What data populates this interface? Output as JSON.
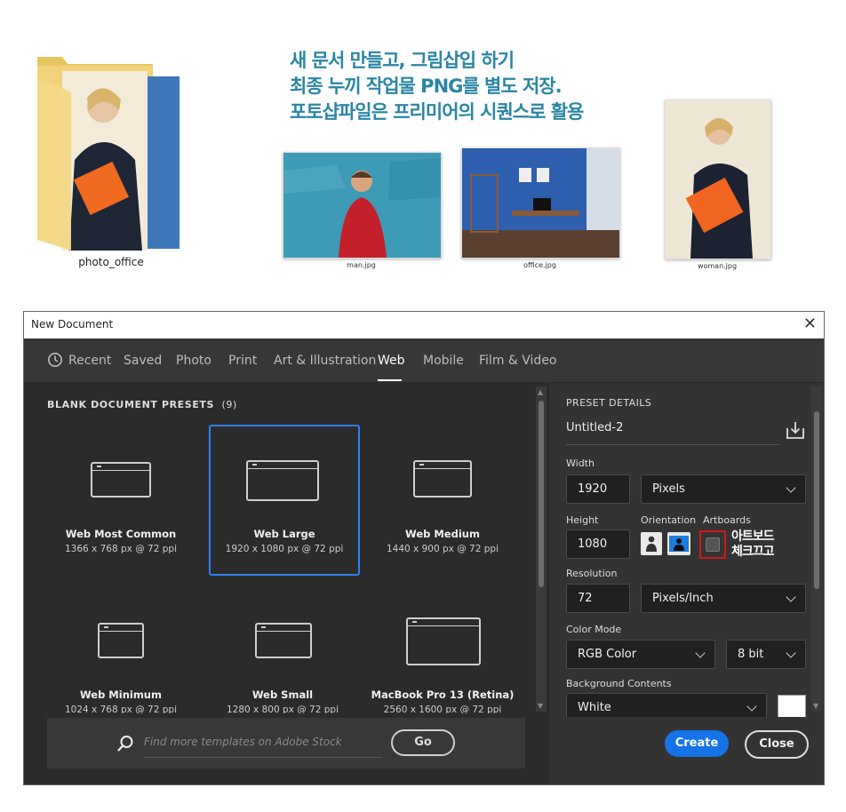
{
  "top": {
    "folder_label": "photo_office",
    "instructions": [
      "새 문서 만들고, 그림삽입 하기",
      "최종 누끼 작업물 PNG를 별도 저장.",
      "포토샵파일은 프리미어의 시퀀스로 활용"
    ],
    "thumbnails": [
      {
        "label": "man.jpg"
      },
      {
        "label": "office.jpg"
      },
      {
        "label": "woman.jpg"
      }
    ]
  },
  "dialog": {
    "title": "New Document",
    "tabs": [
      {
        "label": "Recent"
      },
      {
        "label": "Saved"
      },
      {
        "label": "Photo"
      },
      {
        "label": "Print"
      },
      {
        "label": "Art & Illustration"
      },
      {
        "label": "Web"
      },
      {
        "label": "Mobile"
      },
      {
        "label": "Film & Video"
      }
    ],
    "active_tab": "Web",
    "presets_title": "BLANK DOCUMENT PRESETS",
    "presets_count": "(9)",
    "presets": [
      {
        "name": "Web Most Common",
        "dims": "1366 x 768 px @ 72 ppi"
      },
      {
        "name": "Web Large",
        "dims": "1920 x 1080 px @ 72 ppi"
      },
      {
        "name": "Web Medium",
        "dims": "1440 x 900 px @ 72 ppi"
      },
      {
        "name": "Web Minimum",
        "dims": "1024 x 768 px @ 72 ppi"
      },
      {
        "name": "Web Small",
        "dims": "1280 x 800 px @ 72 ppi"
      },
      {
        "name": "MacBook Pro 13 (Retina)",
        "dims": "2560 x 1600 px @ 72 ppi"
      }
    ],
    "search": {
      "placeholder": "Find more templates on Adobe Stock",
      "go_label": "Go"
    },
    "details": {
      "header": "PRESET DETAILS",
      "name": "Untitled-2",
      "width_label": "Width",
      "width": "1920",
      "width_unit": "Pixels",
      "height_label": "Height",
      "height": "1080",
      "orientation_label": "Orientation",
      "artboards_label": "Artboards",
      "artboard_note": [
        "아트보드",
        "체크끄고"
      ],
      "resolution_label": "Resolution",
      "resolution": "72",
      "resolution_unit": "Pixels/Inch",
      "color_mode_label": "Color Mode",
      "color_mode": "RGB Color",
      "bit_depth": "8 bit",
      "background_label": "Background Contents",
      "background": "White"
    },
    "buttons": {
      "create": "Create",
      "close": "Close"
    }
  },
  "colors": {
    "accent": "#1473e6",
    "selection": "#2e7ef5",
    "annotation": "#2a86a4",
    "highlight_box": "#d01818"
  }
}
